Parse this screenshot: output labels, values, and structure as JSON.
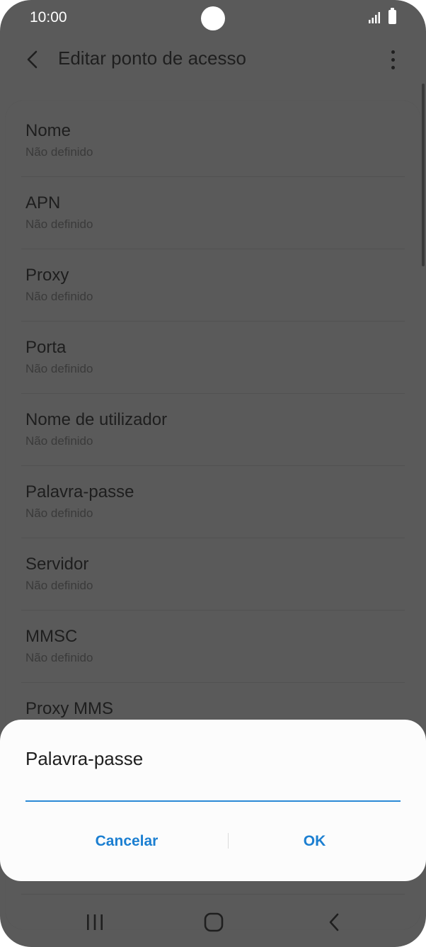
{
  "status_bar": {
    "time": "10:00"
  },
  "header": {
    "title": "Editar ponto de acesso"
  },
  "settings": [
    {
      "label": "Nome",
      "value": "Não definido"
    },
    {
      "label": "APN",
      "value": "Não definido"
    },
    {
      "label": "Proxy",
      "value": "Não definido"
    },
    {
      "label": "Porta",
      "value": "Não definido"
    },
    {
      "label": "Nome de utilizador",
      "value": "Não definido"
    },
    {
      "label": "Palavra-passe",
      "value": "Não definido"
    },
    {
      "label": "Servidor",
      "value": "Não definido"
    },
    {
      "label": "MMSC",
      "value": "Não definido"
    },
    {
      "label": "Proxy MMS",
      "value": ""
    }
  ],
  "dialog": {
    "title": "Palavra-passe",
    "input_value": "",
    "cancel_label": "Cancelar",
    "ok_label": "OK"
  },
  "colors": {
    "scrim_background": "#5a5a5a",
    "dialog_background": "#fcfcfc",
    "accent": "#1c7fd1",
    "field_underline": "#2b8ad6"
  },
  "icons": {
    "back": "chevron-left-icon",
    "more": "more-vertical-icon",
    "signal": "signal-icon",
    "battery": "battery-icon",
    "nav_recents": "recents-icon",
    "nav_home": "home-icon",
    "nav_back": "nav-back-icon"
  }
}
